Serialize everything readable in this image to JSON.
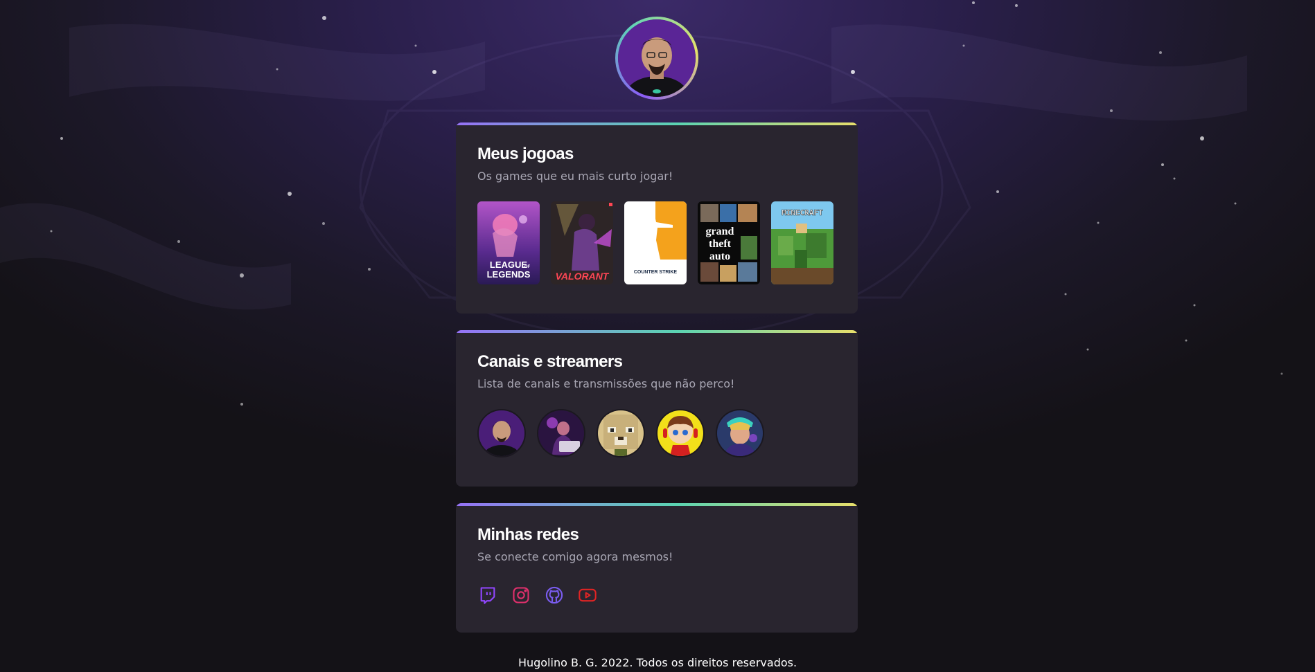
{
  "profile": {
    "avatar_alt": "profile photo"
  },
  "games_card": {
    "title": "Meus jogoas",
    "subtitle": "Os games que eu mais curto jogar!",
    "games": [
      {
        "name": "League of Legends",
        "logo_text_1": "LEAGUE",
        "logo_text_2": "OF",
        "logo_text_3": "LEGENDS"
      },
      {
        "name": "Valorant",
        "logo_text": "VALORANT"
      },
      {
        "name": "Counter Strike",
        "logo_text": "COUNTER STRIKE"
      },
      {
        "name": "Grand Theft Auto V",
        "logo_text_1": "grand",
        "logo_text_2": "theft",
        "logo_text_3": "auto"
      },
      {
        "name": "Minecraft",
        "logo_text": "MINECRAFT"
      }
    ]
  },
  "streamers_card": {
    "title": "Canais e streamers",
    "subtitle": "Lista de canais e transmissões que não perco!"
  },
  "social_card": {
    "title": "Minhas redes",
    "subtitle": "Se conecte comigo agora mesmos!",
    "links": [
      {
        "icon": "twitch-icon",
        "color": "#9146ff"
      },
      {
        "icon": "instagram-icon",
        "color": "#e1306c"
      },
      {
        "icon": "github-icon",
        "color": "#7a5cf0"
      },
      {
        "icon": "youtube-icon",
        "color": "#e02424"
      }
    ]
  },
  "footer": {
    "text": "Hugolino B. G. 2022. Todos os direitos reservados."
  },
  "colors": {
    "accent_gradient": [
      "#9672f7",
      "#5bd4b2",
      "#e8df6b"
    ],
    "card_bg": "#29252f"
  }
}
